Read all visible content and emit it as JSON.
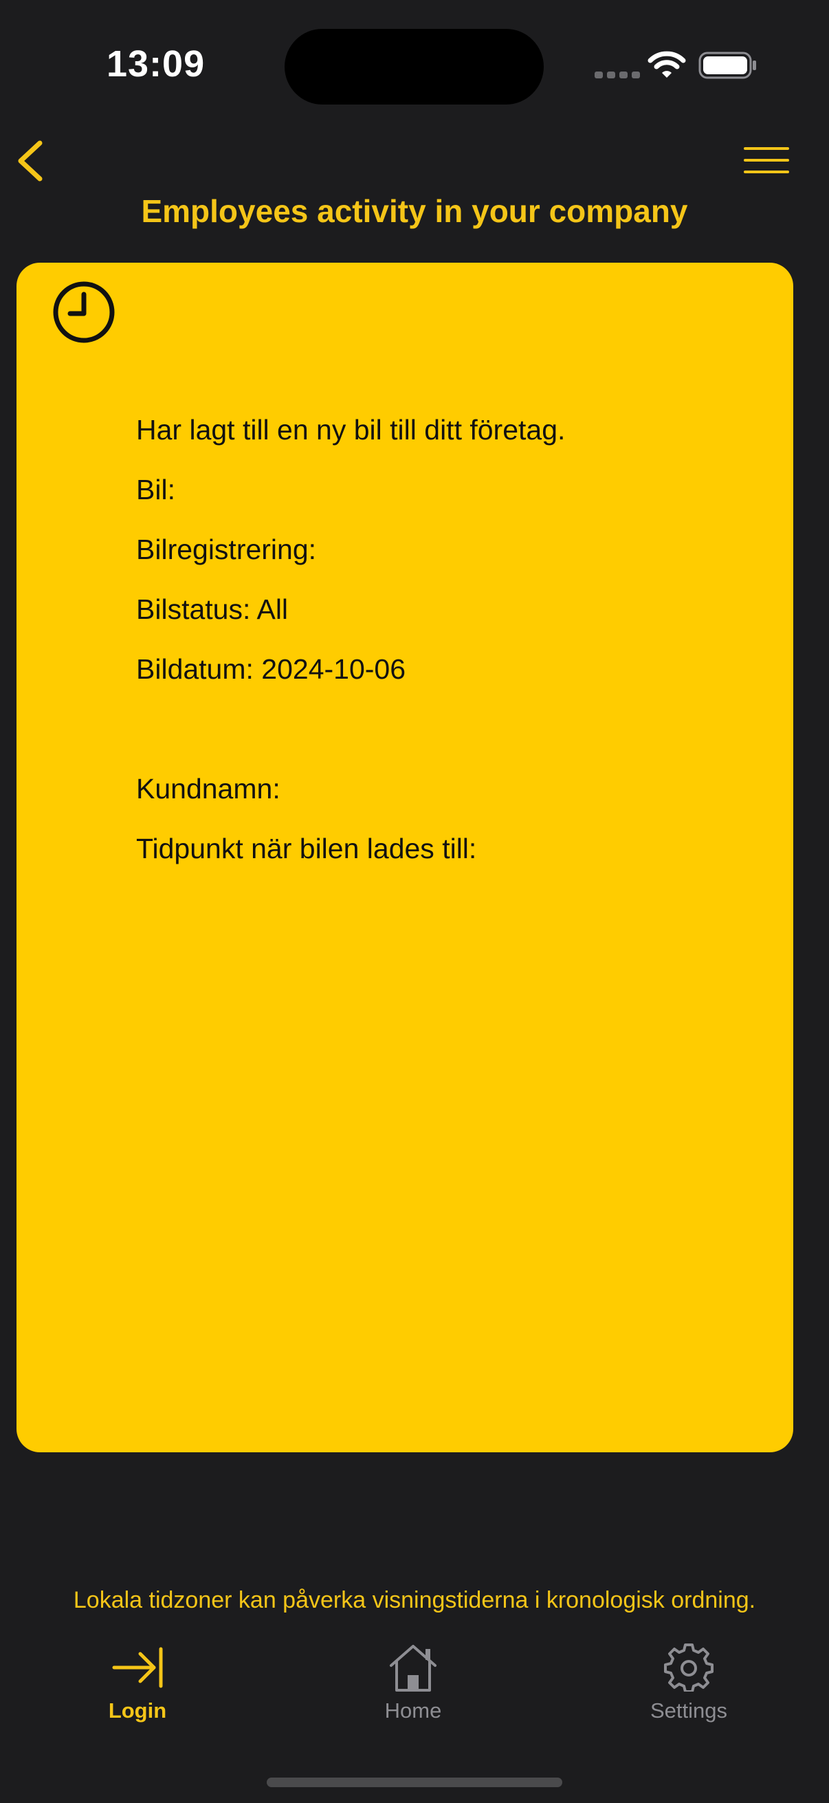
{
  "status_bar": {
    "time": "13:09"
  },
  "header": {
    "title": "Employees activity in your company",
    "back_icon": "chevron-left-icon",
    "menu_icon": "hamburger-menu-icon"
  },
  "activity": {
    "icon": "clock-icon",
    "lines": [
      "Har lagt till en ny bil till ditt företag.",
      "Bil:",
      "Bilregistrering:",
      "Bilstatus: All",
      "Bildatum: 2024-10-06",
      "",
      "Kundnamn:",
      "Tidpunkt när bilen lades till:"
    ]
  },
  "footer_note": "Lokala tidzoner kan påverka visningstiderna i kronologisk ordning.",
  "tab_bar": {
    "tabs": [
      {
        "label": "Login",
        "icon": "login-arrow-icon",
        "active": true
      },
      {
        "label": "Home",
        "icon": "house-icon",
        "active": false
      },
      {
        "label": "Settings",
        "icon": "gear-icon",
        "active": false
      }
    ]
  },
  "colors": {
    "background": "#1c1c1e",
    "accent": "#f5c518",
    "card": "#ffcc00",
    "inactive": "#8e8e93"
  }
}
